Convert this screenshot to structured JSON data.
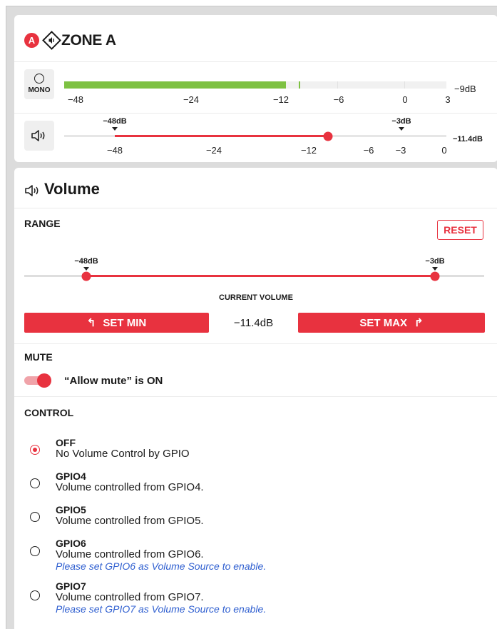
{
  "zone": {
    "badge": "A",
    "title": "ZONE A",
    "meter": {
      "mono_label": "MONO",
      "ticks": [
        "−48",
        "−24",
        "−12",
        "−6",
        "0",
        "3"
      ],
      "readout": "−9dB",
      "level_fraction": 0.58
    },
    "volume": {
      "min_marker": "−48dB",
      "max_marker": "−3dB",
      "ticks": [
        "−48",
        "−24",
        "−12",
        "−6",
        "−3",
        "0"
      ],
      "readout": "−11.4dB",
      "level_fraction": 0.69
    }
  },
  "volume_panel": {
    "title": "Volume",
    "range_label": "RANGE",
    "reset_label": "RESET",
    "min_marker": "−48dB",
    "max_marker": "−3dB",
    "current_label": "CURRENT VOLUME",
    "current_value": "−11.4dB",
    "set_min_label": "SET MIN",
    "set_max_label": "SET MAX",
    "mute_label": "MUTE",
    "mute_text": "“Allow mute” is ON",
    "control_label": "CONTROL",
    "options": [
      {
        "title": "OFF",
        "desc": "No Volume Control by GPIO",
        "note": "",
        "checked": true
      },
      {
        "title": "GPIO4",
        "desc": "Volume controlled from GPIO4.",
        "note": "",
        "checked": false
      },
      {
        "title": "GPIO5",
        "desc": "Volume controlled from GPIO5.",
        "note": "",
        "checked": false
      },
      {
        "title": "GPIO6",
        "desc": "Volume controlled from GPIO6.",
        "note": "Please set GPIO6 as Volume Source to enable.",
        "checked": false
      },
      {
        "title": "GPIO7",
        "desc": "Volume controlled from GPIO7.",
        "note": "Please set GPIO7 as Volume Source to enable.",
        "checked": false
      }
    ]
  },
  "colors": {
    "accent": "#e8323f",
    "meter_green": "#7dc142",
    "note_blue": "#2f5fd0",
    "panel_bg": "#dcdcdc"
  }
}
